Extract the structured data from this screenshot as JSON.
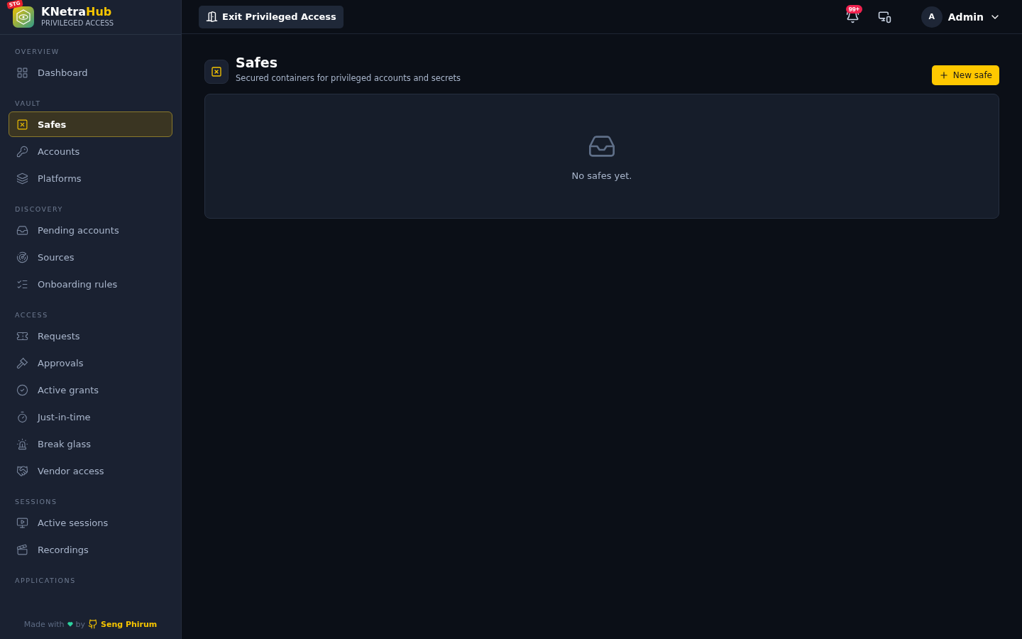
{
  "brand": {
    "badge": "STG",
    "name_part1": "KNetra",
    "name_part2": "Hub",
    "subtitle": "PRIVILEGED ACCESS"
  },
  "sidebar": {
    "sections": [
      {
        "title": "OVERVIEW",
        "items": [
          {
            "label": "Dashboard",
            "selected": false
          }
        ]
      },
      {
        "title": "VAULT",
        "items": [
          {
            "label": "Safes",
            "selected": true
          },
          {
            "label": "Accounts",
            "selected": false
          },
          {
            "label": "Platforms",
            "selected": false
          }
        ]
      },
      {
        "title": "DISCOVERY",
        "items": [
          {
            "label": "Pending accounts",
            "selected": false
          },
          {
            "label": "Sources",
            "selected": false
          },
          {
            "label": "Onboarding rules",
            "selected": false
          }
        ]
      },
      {
        "title": "ACCESS",
        "items": [
          {
            "label": "Requests",
            "selected": false
          },
          {
            "label": "Approvals",
            "selected": false
          },
          {
            "label": "Active grants",
            "selected": false
          },
          {
            "label": "Just-in-time",
            "selected": false
          },
          {
            "label": "Break glass",
            "selected": false
          },
          {
            "label": "Vendor access",
            "selected": false
          }
        ]
      },
      {
        "title": "SESSIONS",
        "items": [
          {
            "label": "Active sessions",
            "selected": false
          },
          {
            "label": "Recordings",
            "selected": false
          }
        ]
      },
      {
        "title": "APPLICATIONS"
      }
    ]
  },
  "footer": {
    "made_with": "Made with",
    "by": "by",
    "author": "Seng Phirum"
  },
  "topbar": {
    "exit_button": "Exit Privileged Access",
    "notification_count": "99+",
    "user": {
      "initial": "A",
      "name": "Admin"
    }
  },
  "page": {
    "title": "Safes",
    "subtitle": "Secured containers for privileged accounts and secrets",
    "new_button": "New safe",
    "empty_text": "No safes yet."
  }
}
